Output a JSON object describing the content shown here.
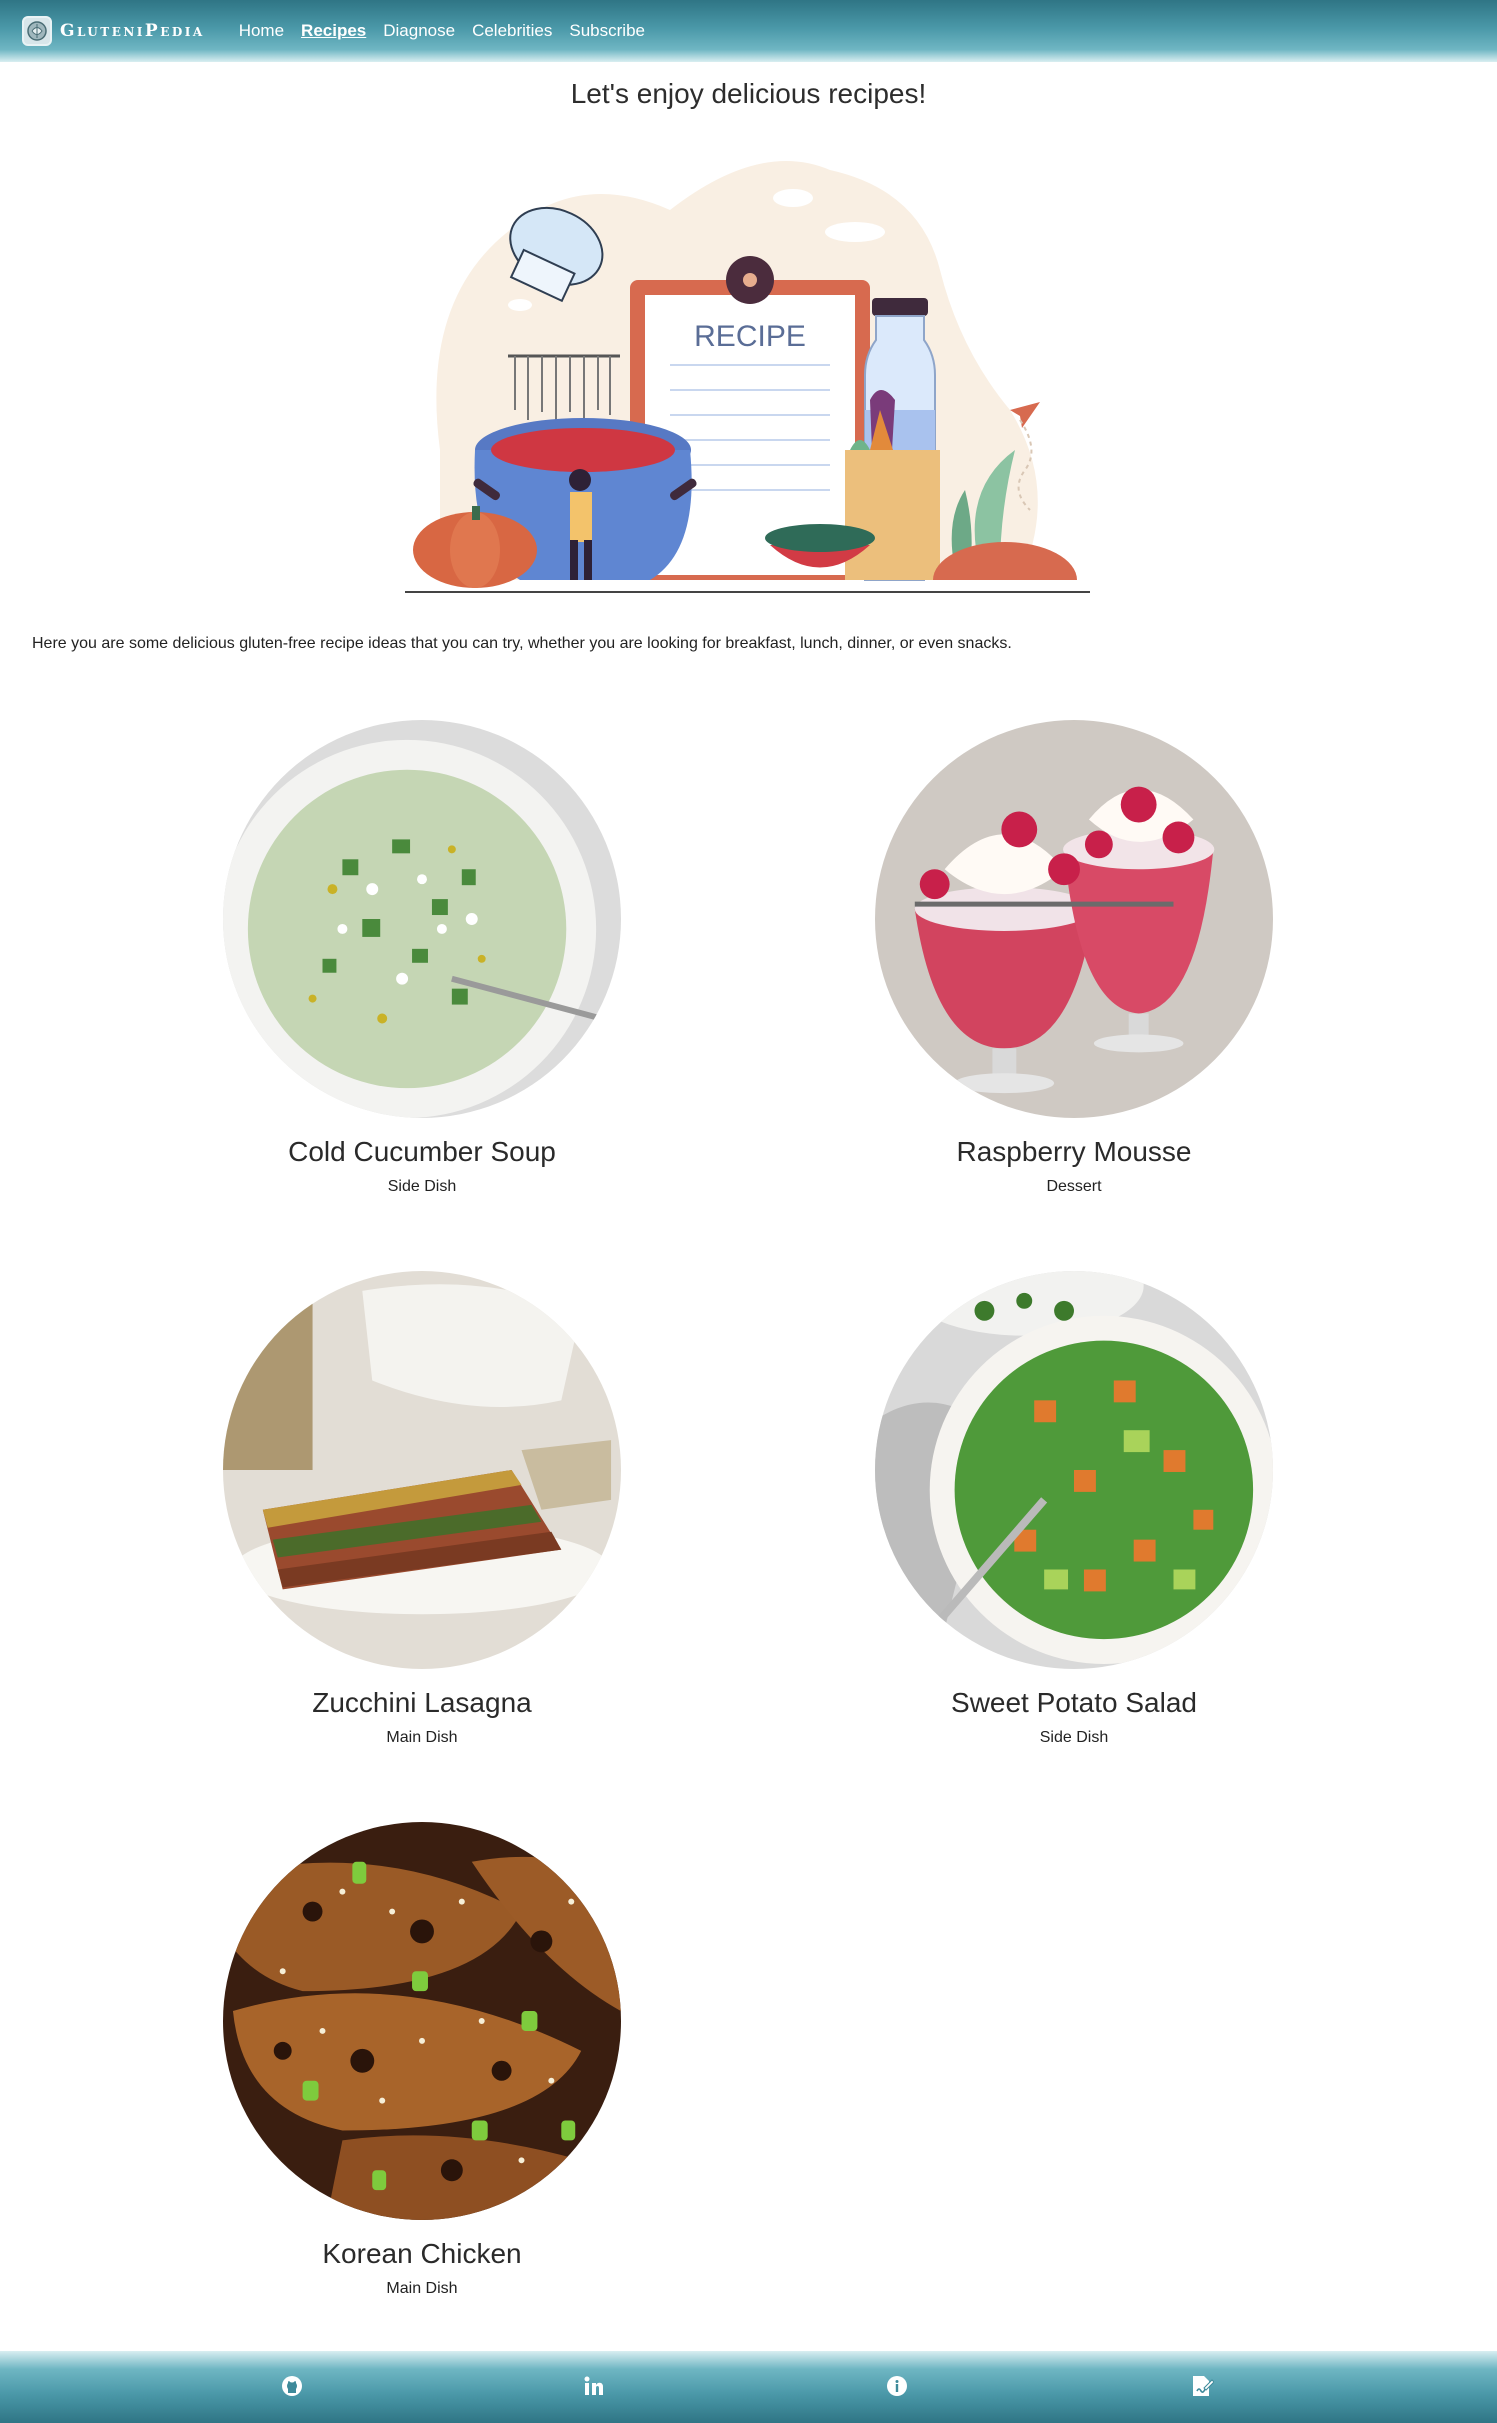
{
  "nav": {
    "brand": "GluteniPedia",
    "links": [
      {
        "label": "Home",
        "active": false
      },
      {
        "label": "Recipes",
        "active": true
      },
      {
        "label": "Diagnose",
        "active": false
      },
      {
        "label": "Celebrities",
        "active": false
      },
      {
        "label": "Subscribe",
        "active": false
      }
    ]
  },
  "hero": {
    "title": "Let's enjoy delicious recipes!",
    "illustration_text": "RECIPE"
  },
  "intro": "Here you are some delicious gluten-free recipe ideas that you can try, whether you are looking for breakfast, lunch, dinner, or even snacks.",
  "recipes": [
    {
      "name": "Cold Cucumber Soup",
      "category": "Side Dish"
    },
    {
      "name": "Raspberry Mousse",
      "category": "Dessert"
    },
    {
      "name": "Zucchini Lasagna",
      "category": "Main Dish"
    },
    {
      "name": "Sweet Potato Salad",
      "category": "Side Dish"
    },
    {
      "name": "Korean Chicken",
      "category": "Main Dish"
    }
  ],
  "footer": {
    "icons": [
      "github-icon",
      "linkedin-icon",
      "info-icon",
      "signature-icon"
    ]
  },
  "colors": {
    "nav_dark": "#2f7585",
    "nav_mid": "#4a98a8",
    "nav_light": "#d9eef1"
  }
}
